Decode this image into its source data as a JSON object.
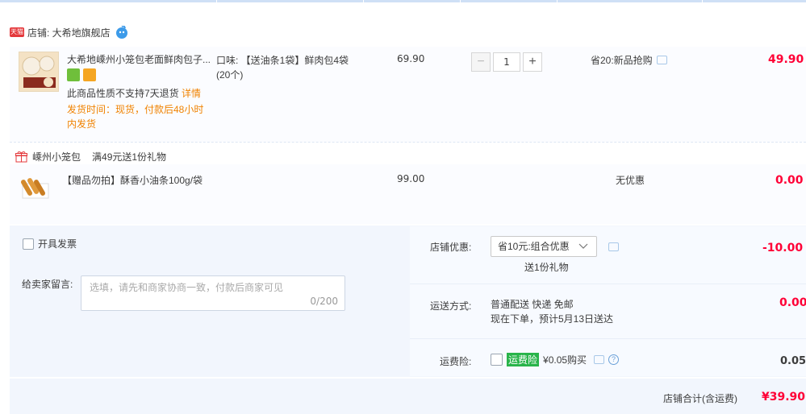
{
  "shop": {
    "badge": "天猫",
    "label": "店铺: 大希地旗舰店"
  },
  "item": {
    "title": "大希地嵊州小笼包老面鲜肉包子...",
    "image_caption": "大希地鲜肉小笼包",
    "flavor_line1": "口味: 【送油条1袋】鲜肉包4袋",
    "flavor_line2": "(20个)",
    "no_return": "此商品性质不支持7天退货",
    "detail_link": "详情",
    "ship_line1": "发货时间：现货，付款后48小时",
    "ship_line2": "内发货",
    "unit_price": "69.90",
    "quantity": "1",
    "promo": "省20:新品抢购",
    "subtotal": "49.90"
  },
  "gift_section": {
    "store_label": "嵊州小笼包",
    "promo_label": "满49元送1份礼物",
    "item_title": "【赠品勿拍】酥香小油条100g/袋",
    "unit_price": "99.00",
    "promo": "无优惠",
    "subtotal": "0.00"
  },
  "invoice": {
    "label": "开具发票"
  },
  "message": {
    "label": "给卖家留言:",
    "placeholder": "选填，请先和商家协商一致，付款后商家可见",
    "counter": "0/200"
  },
  "store_discount": {
    "label": "店铺优惠:",
    "selected": "省10元:组合优惠",
    "gift_note": "送1份礼物",
    "amount": "-10.00"
  },
  "shipping": {
    "label": "运送方式:",
    "method": "普通配送 快递 免邮",
    "eta": "现在下单，预计5月13日送达",
    "amount": "0.00"
  },
  "insurance": {
    "label": "运费险:",
    "badge": "运费险",
    "price": "¥0.05购买",
    "help": "?",
    "amount": "0.05"
  },
  "total": {
    "label": "店铺合计(含运费)",
    "amount": "¥39.90"
  }
}
